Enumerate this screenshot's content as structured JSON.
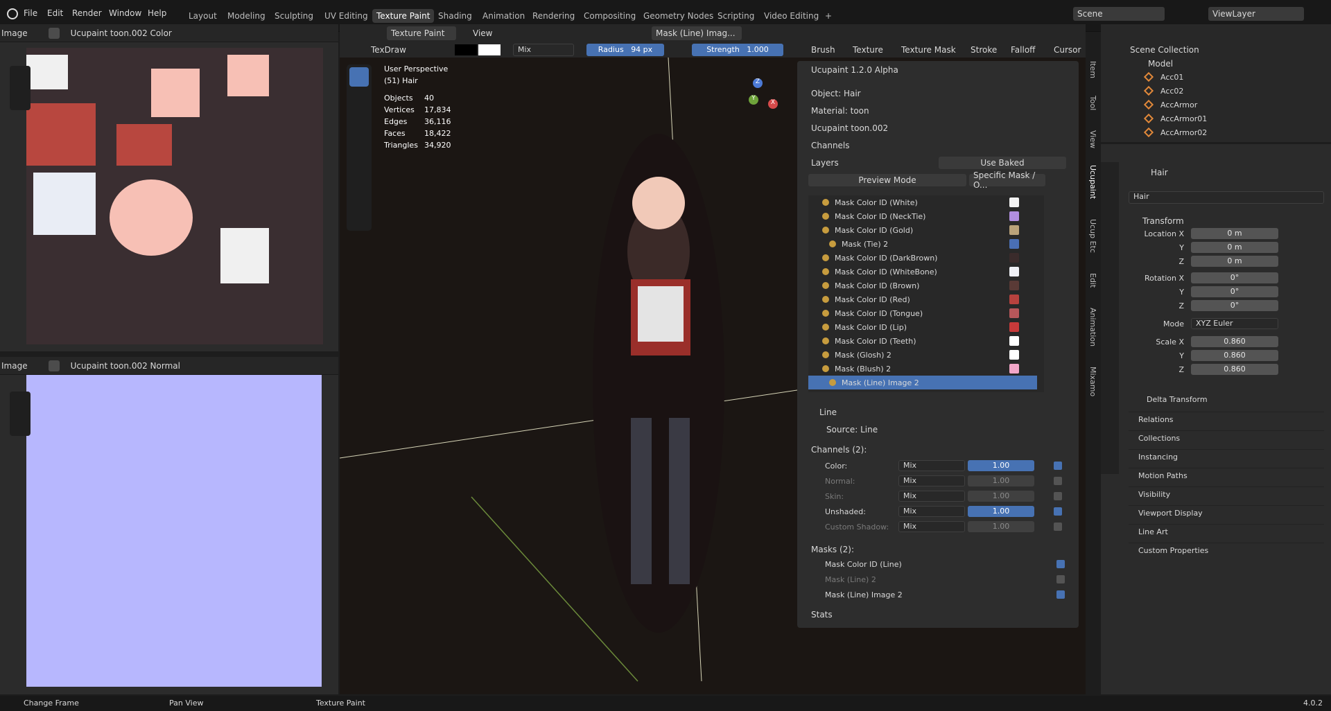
{
  "menus": [
    "File",
    "Edit",
    "Render",
    "Window",
    "Help"
  ],
  "workspaces": [
    "Layout",
    "Modeling",
    "Sculpting",
    "UV Editing",
    "Texture Paint",
    "Shading",
    "Animation",
    "Rendering",
    "Compositing",
    "Geometry Nodes",
    "Scripting",
    "Video Editing"
  ],
  "active_workspace": "Texture Paint",
  "scene": "Scene",
  "view_layer": "ViewLayer",
  "img_editor_top": {
    "label": "Image",
    "image": "Ucupaint toon.002 Color"
  },
  "img_editor_bottom": {
    "label": "Image",
    "image": "Ucupaint toon.002 Normal"
  },
  "viewport_header": {
    "tool": "TexDraw",
    "mode": "Texture Paint",
    "view": "View",
    "mask": "Mask (Line) Imag..."
  },
  "tool_settings": {
    "blend": "Mix",
    "radius_label": "Radius",
    "radius": "94 px",
    "strength_label": "Strength",
    "strength": "1.000",
    "menus": [
      "Brush",
      "Texture",
      "Texture Mask",
      "Stroke",
      "Falloff",
      "Cursor"
    ]
  },
  "overlay": {
    "title": "User Perspective",
    "object": "(51) Hair",
    "stats": [
      [
        "Objects",
        "40"
      ],
      [
        "Vertices",
        "17,834"
      ],
      [
        "Edges",
        "36,116"
      ],
      [
        "Faces",
        "18,422"
      ],
      [
        "Triangles",
        "34,920"
      ]
    ]
  },
  "gizmo": {
    "x": "X",
    "y": "Y",
    "z": "Z"
  },
  "ucupaint": {
    "title": "Ucupaint 1.2.0 Alpha",
    "object": "Object: Hair",
    "material": "Material: toon",
    "node": "Ucupaint toon.002",
    "channels": "Channels",
    "layers": "Layers",
    "use_baked": "Use Baked",
    "preview_mode": "Preview Mode",
    "specific_mask": "Specific Mask / O...",
    "layer_list": [
      {
        "name": "Mask Color ID (White)",
        "color": "#f2f2f2",
        "indent": false
      },
      {
        "name": "Mask Color ID (NeckTie)",
        "color": "#b18ee0",
        "indent": false
      },
      {
        "name": "Mask Color ID (Gold)",
        "color": "#b9a27a",
        "indent": false
      },
      {
        "name": "Mask (Tie) 2",
        "color": "#4a6fb5",
        "indent": true
      },
      {
        "name": "Mask Color ID (DarkBrown)",
        "color": "#3a2b2b",
        "indent": false
      },
      {
        "name": "Mask Color ID (WhiteBone)",
        "color": "#eef0f5",
        "indent": false
      },
      {
        "name": "Mask Color ID (Brown)",
        "color": "#5a3a36",
        "indent": false
      },
      {
        "name": "Mask Color ID (Red)",
        "color": "#b8423e",
        "indent": false
      },
      {
        "name": "Mask Color ID (Tongue)",
        "color": "#b8575a",
        "indent": false
      },
      {
        "name": "Mask Color ID (Lip)",
        "color": "#c83a3a",
        "indent": false
      },
      {
        "name": "Mask Color ID (Teeth)",
        "color": "#ffffff",
        "indent": false
      },
      {
        "name": "Mask (Glosh) 2",
        "color": "#ffffff",
        "indent": false
      },
      {
        "name": "Mask (Blush) 2",
        "color": "#f2a6c8",
        "indent": false
      },
      {
        "name": "Mask (Line) Image 2",
        "color": "",
        "indent": true
      }
    ],
    "line_section": "Line",
    "source": "Source: Line",
    "channels_header": "Channels (2):",
    "channel_rows": [
      {
        "label": "Color:",
        "blend": "Mix",
        "value": "1.00",
        "enabled": true
      },
      {
        "label": "Normal:",
        "blend": "Mix",
        "value": "1.00",
        "enabled": false
      },
      {
        "label": "Skin:",
        "blend": "Mix",
        "value": "1.00",
        "enabled": false
      },
      {
        "label": "Unshaded:",
        "blend": "Mix",
        "value": "1.00",
        "enabled": true
      },
      {
        "label": "Custom Shadow:",
        "blend": "Mix",
        "value": "1.00",
        "enabled": false
      }
    ],
    "masks_header": "Masks (2):",
    "mask_rows": [
      {
        "label": "Mask Color ID (Line)",
        "enabled": true
      },
      {
        "label": "Mask (Line) 2",
        "enabled": false
      },
      {
        "label": "Mask (Line) Image 2",
        "enabled": true
      }
    ],
    "stats": "Stats"
  },
  "side_tabs": [
    "Item",
    "Tool",
    "View",
    "Ucupaint",
    "Ucup Etc",
    "Edit",
    "Animation",
    "Mixamo"
  ],
  "outliner": {
    "root": "Scene Collection",
    "collection": "Model",
    "items": [
      "Acc01",
      "Acc02",
      "AccArmor",
      "AccArmor01",
      "AccArmor02"
    ]
  },
  "properties": {
    "object": "Hair",
    "data_name": "Hair",
    "transform": "Transform",
    "rows": [
      [
        "Location X",
        "0 m"
      ],
      [
        "Y",
        "0 m"
      ],
      [
        "Z",
        "0 m"
      ],
      [
        "Rotation X",
        "0°"
      ],
      [
        "Y",
        "0°"
      ],
      [
        "Z",
        "0°"
      ]
    ],
    "mode_label": "Mode",
    "mode": "XYZ Euler",
    "scale": [
      [
        "Scale X",
        "0.860"
      ],
      [
        "Y",
        "0.860"
      ],
      [
        "Z",
        "0.860"
      ]
    ],
    "delta": "Delta Transform",
    "sections": [
      "Relations",
      "Collections",
      "Instancing",
      "Motion Paths",
      "Visibility",
      "Viewport Display",
      "Line Art",
      "Custom Properties"
    ]
  },
  "status": {
    "a": "Change Frame",
    "b": "Pan View",
    "c": "Texture Paint",
    "version": "4.0.2"
  }
}
